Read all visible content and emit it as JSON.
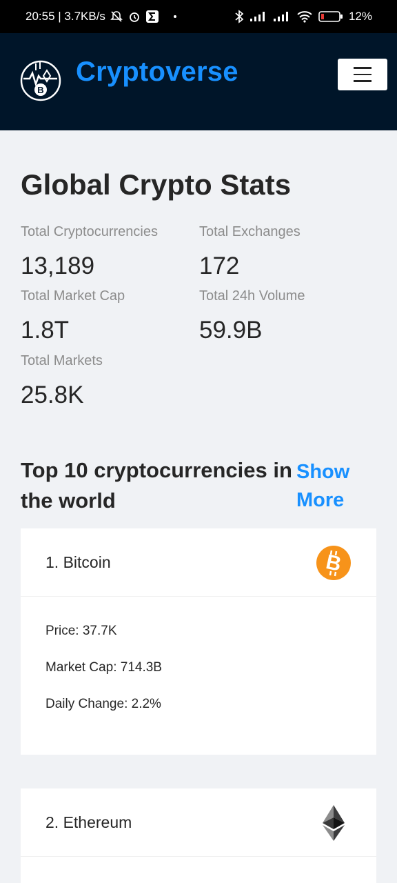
{
  "status_bar": {
    "time_info": "20:55 | 3.7KB/s",
    "battery": "12%"
  },
  "navbar": {
    "brand": "Cryptoverse",
    "brand_color": "#1890ff",
    "background": "#001529"
  },
  "global_stats": {
    "title": "Global Crypto Stats",
    "stats": [
      {
        "label": "Total Cryptocurrencies",
        "value": "13,189"
      },
      {
        "label": "Total Exchanges",
        "value": "172"
      },
      {
        "label": "Total Market Cap",
        "value": "1.8T"
      },
      {
        "label": "Total 24h Volume",
        "value": "59.9B"
      },
      {
        "label": "Total Markets",
        "value": "25.8K"
      }
    ]
  },
  "top10": {
    "title": "Top 10 cryptocurrencies in the world",
    "show_more": "Show More"
  },
  "cards": [
    {
      "title": "1. Bitcoin",
      "icon": "bitcoin-icon",
      "icon_color": "#f7931a",
      "lines": [
        "Price: 37.7K",
        "Market Cap: 714.3B",
        "Daily Change: 2.2%"
      ]
    },
    {
      "title": "2. Ethereum",
      "icon": "ethereum-icon"
    }
  ]
}
